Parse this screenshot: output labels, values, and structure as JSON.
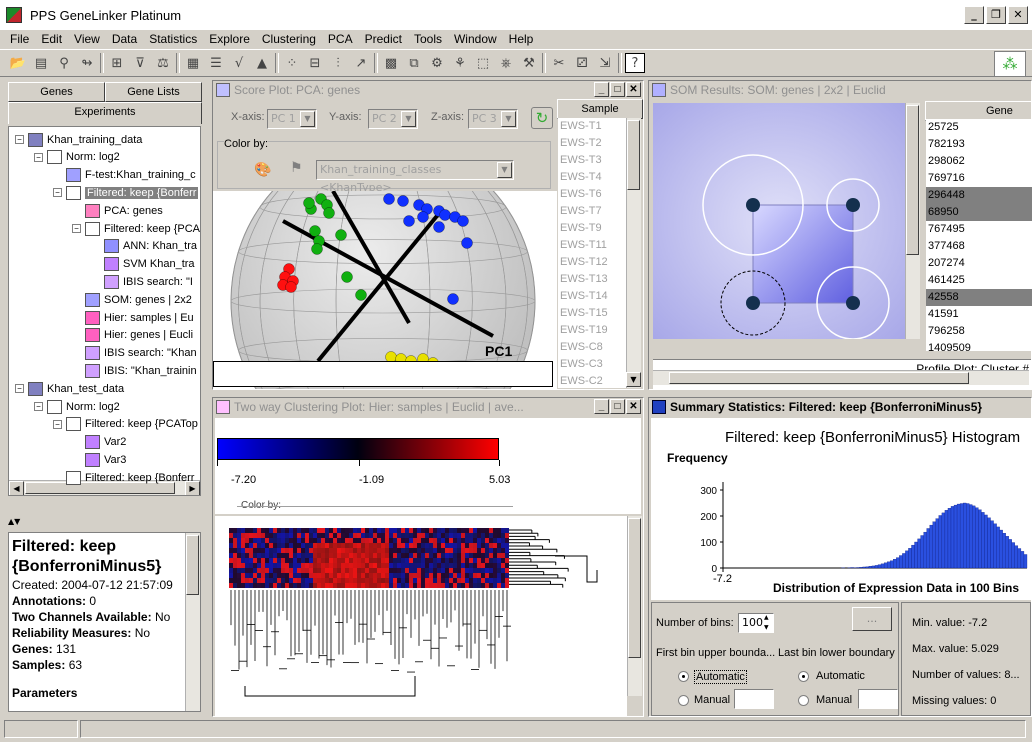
{
  "window": {
    "title": "PPS GeneLinker Platinum"
  },
  "menu": [
    "File",
    "Edit",
    "View",
    "Data",
    "Statistics",
    "Explore",
    "Clustering",
    "PCA",
    "Predict",
    "Tools",
    "Window",
    "Help"
  ],
  "left_tabs": {
    "genes": "Genes",
    "gene_lists": "Gene Lists",
    "experiments": "Experiments"
  },
  "tree": [
    {
      "label": "Khan_training_data",
      "depth": 0,
      "icon": "dataset-icon",
      "exp": "−"
    },
    {
      "label": "Norm: log2",
      "depth": 1,
      "icon": "table-icon",
      "exp": "−"
    },
    {
      "label": "F-test:Khan_training_c",
      "depth": 2,
      "icon": "ftest-icon"
    },
    {
      "label": "Filtered: keep {Bonferr",
      "depth": 2,
      "icon": "table-icon",
      "exp": "−",
      "selected": true
    },
    {
      "label": "PCA: genes",
      "depth": 3,
      "icon": "pca-icon"
    },
    {
      "label": "Filtered: keep {PCA",
      "depth": 3,
      "icon": "table-icon",
      "exp": "−"
    },
    {
      "label": "ANN: Khan_tra",
      "depth": 4,
      "icon": "ann-icon"
    },
    {
      "label": "SVM Khan_tra",
      "depth": 4,
      "icon": "svm-icon"
    },
    {
      "label": "IBIS search: \"I",
      "depth": 4,
      "icon": "ibis-icon"
    },
    {
      "label": "SOM: genes  | 2x2",
      "depth": 3,
      "icon": "som-icon"
    },
    {
      "label": "Hier: samples  | Eu",
      "depth": 3,
      "icon": "hier-icon"
    },
    {
      "label": "Hier: genes  | Eucli",
      "depth": 3,
      "icon": "hier-icon"
    },
    {
      "label": "IBIS search: \"Khan",
      "depth": 3,
      "icon": "ibis-icon"
    },
    {
      "label": "IBIS: \"Khan_trainin",
      "depth": 3,
      "icon": "ibis-icon"
    },
    {
      "label": "Khan_test_data",
      "depth": 0,
      "icon": "dataset-icon",
      "exp": "−"
    },
    {
      "label": "Norm: log2",
      "depth": 1,
      "icon": "table-icon",
      "exp": "−"
    },
    {
      "label": "Filtered: keep {PCATop",
      "depth": 2,
      "icon": "table-icon",
      "exp": "−"
    },
    {
      "label": "Var2",
      "depth": 3,
      "icon": "var-icon"
    },
    {
      "label": "Var3",
      "depth": 3,
      "icon": "var-icon"
    },
    {
      "label": "Filtered: keep {Bonferr",
      "depth": 2,
      "icon": "table-icon"
    }
  ],
  "info": {
    "title1": "Filtered: keep",
    "title2": "{BonferroniMinus5}",
    "created": "Created: 2004-07-12 21:57:09",
    "annotations": {
      "label": "Annotations:",
      "value": "0"
    },
    "two_channels": {
      "label": "Two Channels Available:",
      "value": "No"
    },
    "reliability": {
      "label": "Reliability Measures:",
      "value": "No"
    },
    "genes": {
      "label": "Genes:",
      "value": "131"
    },
    "samples": {
      "label": "Samples:",
      "value": "63"
    },
    "parameters": "Parameters"
  },
  "score_plot": {
    "title": "Score Plot: PCA: genes",
    "x_label": "X-axis:",
    "x_value": "PC 1",
    "y_label": "Y-axis:",
    "y_value": "PC 2",
    "z_label": "Z-axis:",
    "z_value": "PC 3",
    "color_by": "Color by:",
    "color_value": "Khan_training_classes <KhanType>",
    "axis_label": "PC1",
    "sample_header": "Sample",
    "samples": [
      "EWS-T1",
      "EWS-T2",
      "EWS-T3",
      "EWS-T4",
      "EWS-T6",
      "EWS-T7",
      "EWS-T9",
      "EWS-T11",
      "EWS-T12",
      "EWS-T13",
      "EWS-T14",
      "EWS-T15",
      "EWS-T19",
      "EWS-C8",
      "EWS-C3",
      "EWS-C2"
    ]
  },
  "som": {
    "title": "SOM Results: SOM: genes   |  2x2   |  Euclid",
    "gene_header": "Gene",
    "genes": [
      {
        "id": "25725"
      },
      {
        "id": "782193"
      },
      {
        "id": "298062"
      },
      {
        "id": "769716"
      },
      {
        "id": "296448",
        "hl": true
      },
      {
        "id": "68950",
        "hl": true
      },
      {
        "id": "767495"
      },
      {
        "id": "377468"
      },
      {
        "id": "207274"
      },
      {
        "id": "461425"
      },
      {
        "id": "42558",
        "hl": true
      },
      {
        "id": "41591"
      },
      {
        "id": "796258"
      },
      {
        "id": "1409509"
      }
    ],
    "profile_label": "Profile Plot: Cluster #"
  },
  "clustering": {
    "title": "Two way Clustering Plot: Hier: samples   |  Euclid  |  ave...",
    "scale_min": "-7.20",
    "scale_mid": "-1.09",
    "scale_max": "5.03",
    "color_by": "Color by:"
  },
  "summary": {
    "title": "Summary Statistics: Filtered: keep {BonferroniMinus5}",
    "heading": "Filtered: keep {BonferroniMinus5} Histogram",
    "freq_label": "Frequency",
    "dist_label": "Distribution of Expression Data in 100 Bins",
    "num_bins_label": "Number of bins:",
    "num_bins": "100",
    "first_bin": "First bin upper bounda...",
    "last_bin": "Last bin lower boundary",
    "automatic": "Automatic",
    "manual": "Manual",
    "browse": "...",
    "min_value": "Min. value: -7.2",
    "max_value": "Max. value: 5.029",
    "num_values": "Number of values: 8...",
    "missing": "Missing values: 0"
  },
  "chart_data": {
    "type": "bar",
    "title": "Filtered: keep {BonferroniMinus5} Histogram",
    "xlabel": "Distribution of Expression Data in 100 Bins",
    "ylabel": "Frequency",
    "ylim": [
      0,
      300
    ],
    "yticks": [
      0,
      100,
      200,
      300
    ],
    "xtick_labels": [
      "-7.2"
    ],
    "values": [
      0,
      0,
      0,
      0,
      0,
      0,
      0,
      0,
      0,
      0,
      0,
      0,
      0,
      0,
      0,
      0,
      0,
      0,
      0,
      0,
      0,
      0,
      0,
      0,
      0,
      0,
      0,
      0,
      0,
      0,
      0,
      0,
      0,
      0,
      0,
      0,
      0,
      0,
      0,
      1,
      0,
      1,
      2,
      1,
      2,
      3,
      4,
      5,
      7,
      8,
      10,
      13,
      16,
      20,
      24,
      28,
      34,
      40,
      48,
      56,
      66,
      76,
      88,
      100,
      112,
      125,
      138,
      152,
      165,
      178,
      190,
      202,
      212,
      222,
      230,
      237,
      242,
      246,
      248,
      250,
      248,
      244,
      239,
      232,
      224,
      214,
      204,
      193,
      182,
      170,
      158,
      146,
      134,
      122,
      110,
      98,
      86,
      75,
      64,
      52
    ]
  },
  "colors": {
    "pca_red": "#ff1010",
    "pca_green": "#10b010",
    "pca_blue": "#1030ff",
    "pca_yellow": "#e8e000",
    "hist_bar": "#2a50e0",
    "tree_select": "#808080"
  }
}
